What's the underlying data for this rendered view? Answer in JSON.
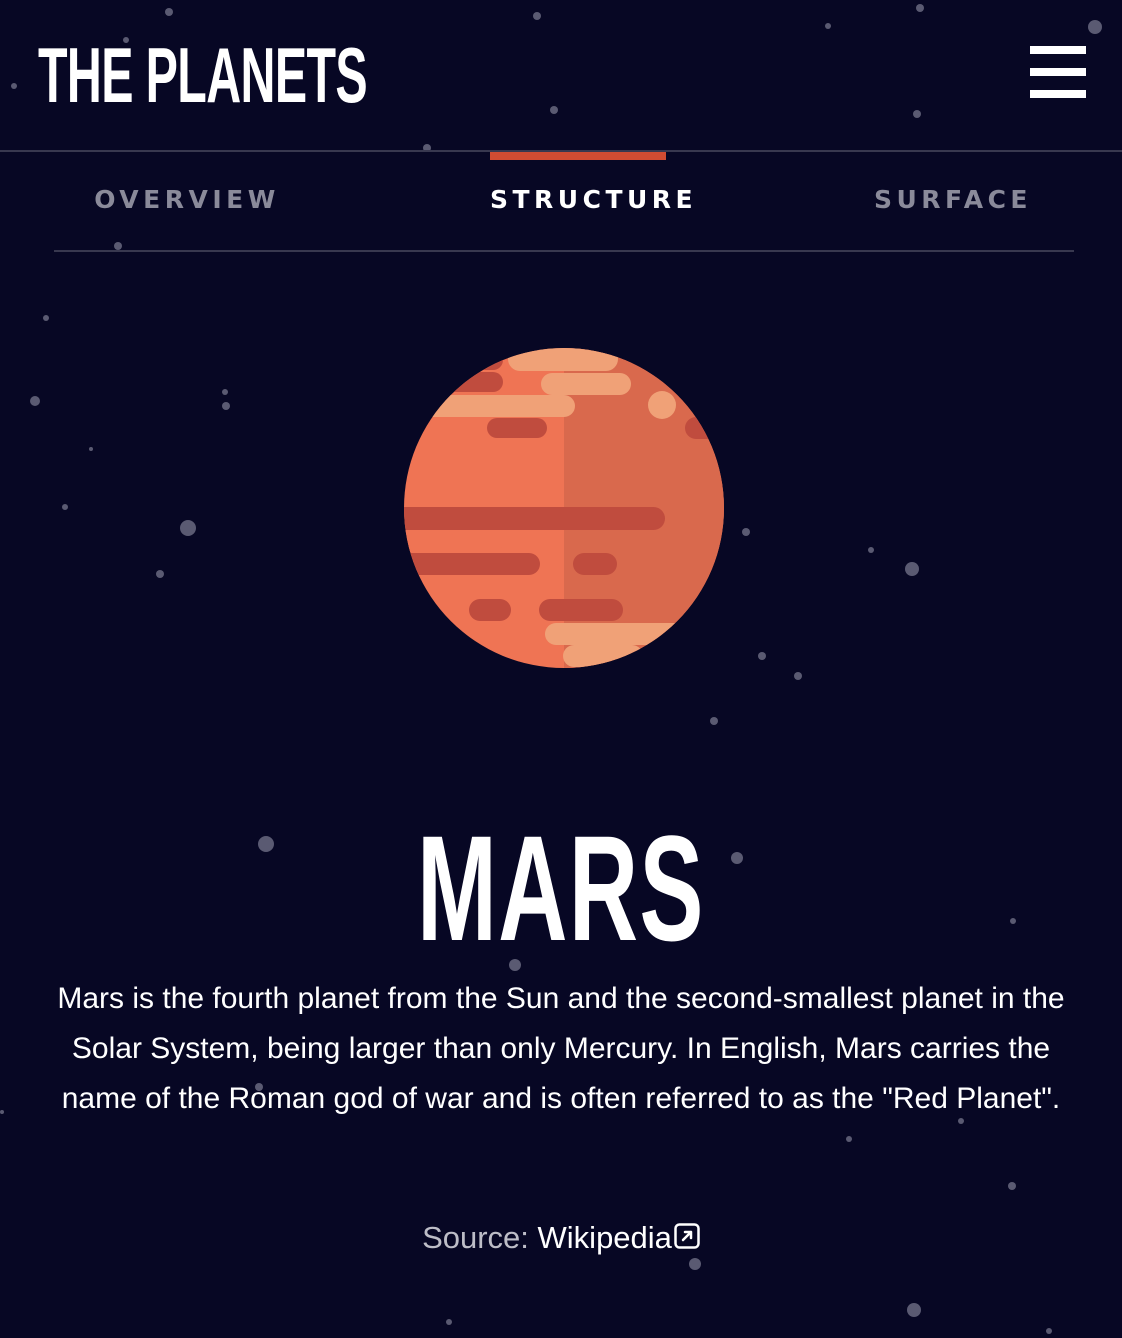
{
  "header": {
    "title": "THE PLANETS",
    "menu_icon": "hamburger-menu-icon"
  },
  "tabs": [
    {
      "label": "OVERVIEW",
      "active": false
    },
    {
      "label": "STRUCTURE",
      "active": true
    },
    {
      "label": "SURFACE",
      "active": false
    }
  ],
  "planet": {
    "name": "MARS",
    "illustration": "mars-planet-illustration",
    "description": "Mars is the fourth planet from the Sun and the second-smallest planet in the Solar System, being larger than only Mercury. In English, Mars carries the name of the Roman god of war and is often referred to as the \"Red Planet\".",
    "source_label": "Source:",
    "source_link": "Wikipedia",
    "source_icon": "external-link-icon"
  },
  "colors": {
    "background": "#070724",
    "accent": "#d14c32",
    "divider": "#38384f",
    "inactive_tab": "#8a8a9a",
    "planet_base": "#ef7454",
    "planet_shadow": "#d9694d",
    "planet_band_dark": "#c04c3e",
    "planet_band_light": "#f0a177"
  }
}
